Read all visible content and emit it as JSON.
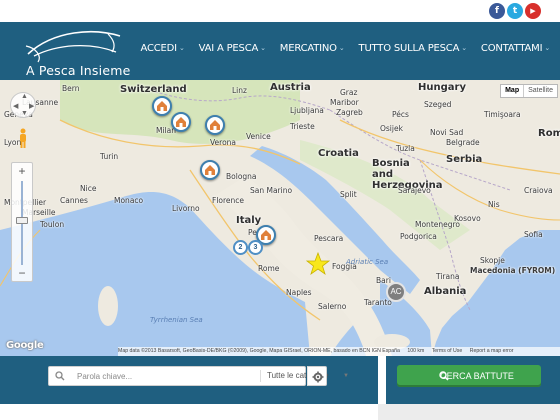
{
  "social": {
    "facebook_glyph": "f",
    "twitter_glyph": "t",
    "youtube_glyph": "▶"
  },
  "header": {
    "brand": "A Pesca Insieme",
    "nav": [
      {
        "label": "ACCEDI"
      },
      {
        "label": "VAI A PESCA"
      },
      {
        "label": "MERCATINO"
      },
      {
        "label": "TUTTO SULLA PESCA"
      },
      {
        "label": "CONTATTAMI"
      }
    ]
  },
  "map": {
    "map_types": [
      "Map",
      "Satellite"
    ],
    "countries": [
      "Switzerland",
      "Austria",
      "Hungary",
      "Croatia",
      "Bosnia and Herzegovina",
      "Serbia",
      "Montenegro",
      "Albania",
      "Macedonia (FYROM)",
      "Italy",
      "Monaco",
      "Rom"
    ],
    "places": [
      "Bern",
      "Lausanne",
      "Geneva",
      "Lyon",
      "Turin",
      "Milan",
      "Verona",
      "Venice",
      "Trieste",
      "Zagreb",
      "Ljubljana",
      "Bologna",
      "San Marino",
      "Florence",
      "Livorno",
      "Perugia",
      "Pescara",
      "Rome",
      "Naples",
      "Foggia",
      "Bari",
      "Taranto",
      "Salerno",
      "Split",
      "Sarajevo",
      "Belgrade",
      "Nis",
      "Kosovo",
      "Podgorica",
      "Skopje",
      "Tirana",
      "Marseille",
      "Nice",
      "Cannes",
      "Toulon",
      "Montpellier",
      "Graz",
      "Maribor",
      "Pécs",
      "Novi Sad",
      "Timişoara",
      "Craiova",
      "Sofia",
      "Osijek",
      "Tuzla",
      "Szeged",
      "Linz"
    ],
    "seas": [
      "Adriatic Sea",
      "Tyrrhenian Sea"
    ],
    "cluster_labels": [
      "2",
      "3"
    ],
    "dark_cluster_label": "AC",
    "google_logo": "Google",
    "attribution": [
      "Map data ©2013 Basarsoft, GeoBasis-DE/BKG (©2009), Google, Mapa GISrael, ORION-ME, basado en BCN IGN España",
      "100 km",
      "Terms of Use",
      "Report a map error"
    ]
  },
  "search": {
    "placeholder": "Parola chiave...",
    "category_value": "Tutte le categorie",
    "button_label": "CERCA BATTUTE"
  },
  "colors": {
    "header_bg": "#1f5f80",
    "button_green": "#3fa34d",
    "marker_border": "#3e7fae"
  }
}
